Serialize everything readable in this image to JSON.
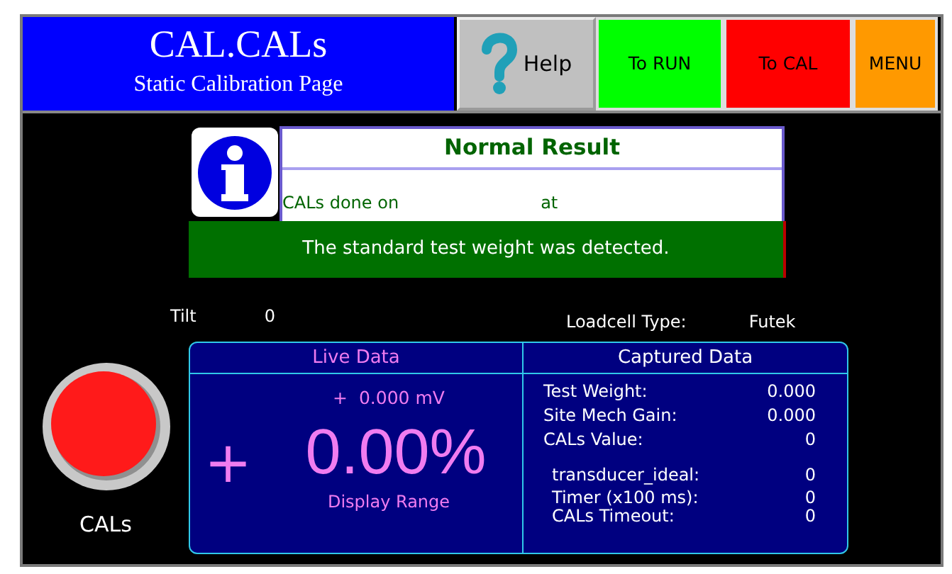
{
  "header": {
    "title": "CAL.CALs",
    "subtitle": "Static Calibration Page"
  },
  "nav_buttons": [
    {
      "kind": "help",
      "label": "Help",
      "color": "#c0c0c0"
    },
    {
      "kind": "nav",
      "label": "To RUN",
      "color": "#00ff00"
    },
    {
      "kind": "nav",
      "label": "To CAL",
      "color": "#ff0000"
    },
    {
      "kind": "nav",
      "label": "MENU",
      "color": "#ff9900"
    }
  ],
  "result": {
    "title": "Normal Result",
    "done_label": "CALs done on",
    "at_label": "at",
    "message": "The standard test weight was detected."
  },
  "tilt": {
    "label": "Tilt",
    "value": "0"
  },
  "loadcell": {
    "label": "Loadcell Type:",
    "value": "Futek"
  },
  "cal_button": {
    "label": "CALs"
  },
  "live_data": {
    "title": "Live Data",
    "sign": "+",
    "millivolts": "+  0.000 mV",
    "percent": "0.00%",
    "caption": "Display Range"
  },
  "captured_data": {
    "title": "Captured Data",
    "rows": [
      {
        "kind": "normal",
        "label": "Test Weight:",
        "value": "0.000"
      },
      {
        "kind": "normal",
        "label": "Site Mech Gain:",
        "value": "0.000"
      },
      {
        "kind": "normal",
        "label": "CALs Value:",
        "value": "0"
      },
      {
        "kind": "indented",
        "label": "transducer_ideal:",
        "value": "0"
      },
      {
        "kind": "compact",
        "label": "Timer (x100 ms):",
        "value": "0"
      },
      {
        "kind": "compact",
        "label": "CALs Timeout:",
        "value": "0"
      }
    ]
  }
}
